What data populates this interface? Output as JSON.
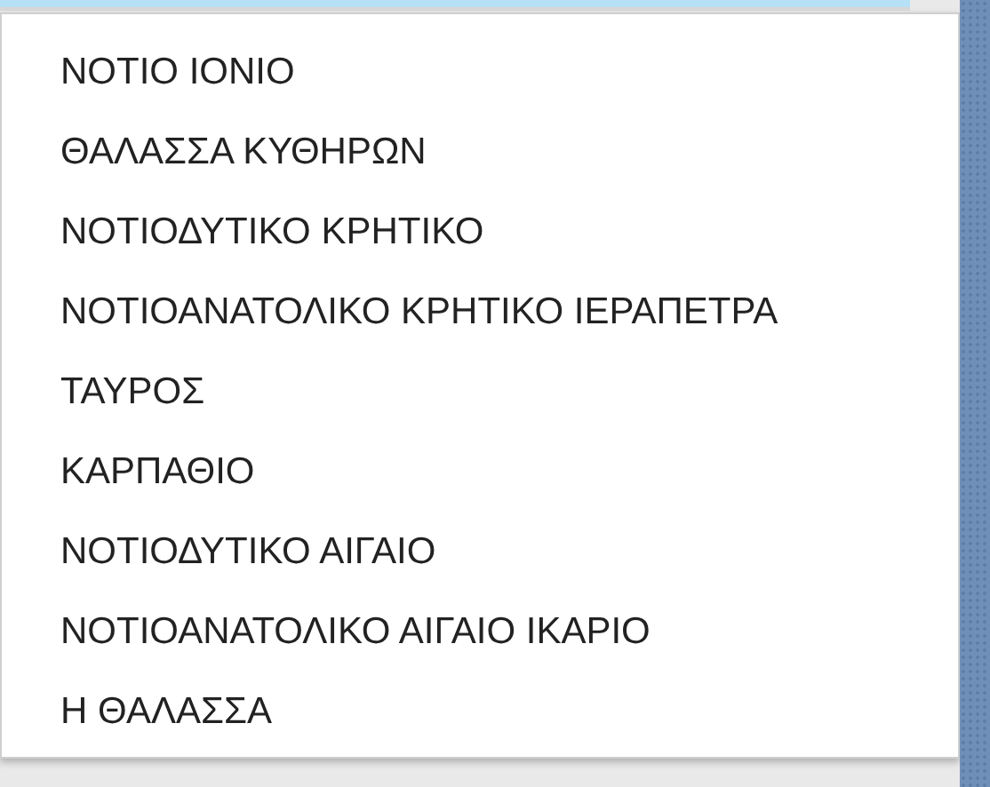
{
  "dropdown": {
    "items": [
      {
        "label": "ΝΟΤΙΟ ΙΟΝΙΟ"
      },
      {
        "label": "ΘΑΛΑΣΣΑ ΚΥΘΗΡΩΝ"
      },
      {
        "label": "ΝΟΤΙΟΔΥΤΙΚΟ ΚΡΗΤΙΚΟ"
      },
      {
        "label": "ΝΟΤΙΟΑΝΑΤΟΛΙΚΟ ΚΡΗΤΙΚΟ ΙΕΡΑΠΕΤΡΑ"
      },
      {
        "label": "ΤΑΥΡΟΣ"
      },
      {
        "label": "ΚΑΡΠΑΘΙΟ"
      },
      {
        "label": "ΝΟΤΙΟΔΥΤΙΚΟ ΑΙΓΑΙΟ"
      },
      {
        "label": "ΝΟΤΙΟΑΝΑΤΟΛΙΚΟ ΑΙΓΑΙΟ ΙΚΑΡΙΟ"
      },
      {
        "label": "Η ΘΑΛΑΣΣΑ"
      }
    ]
  }
}
